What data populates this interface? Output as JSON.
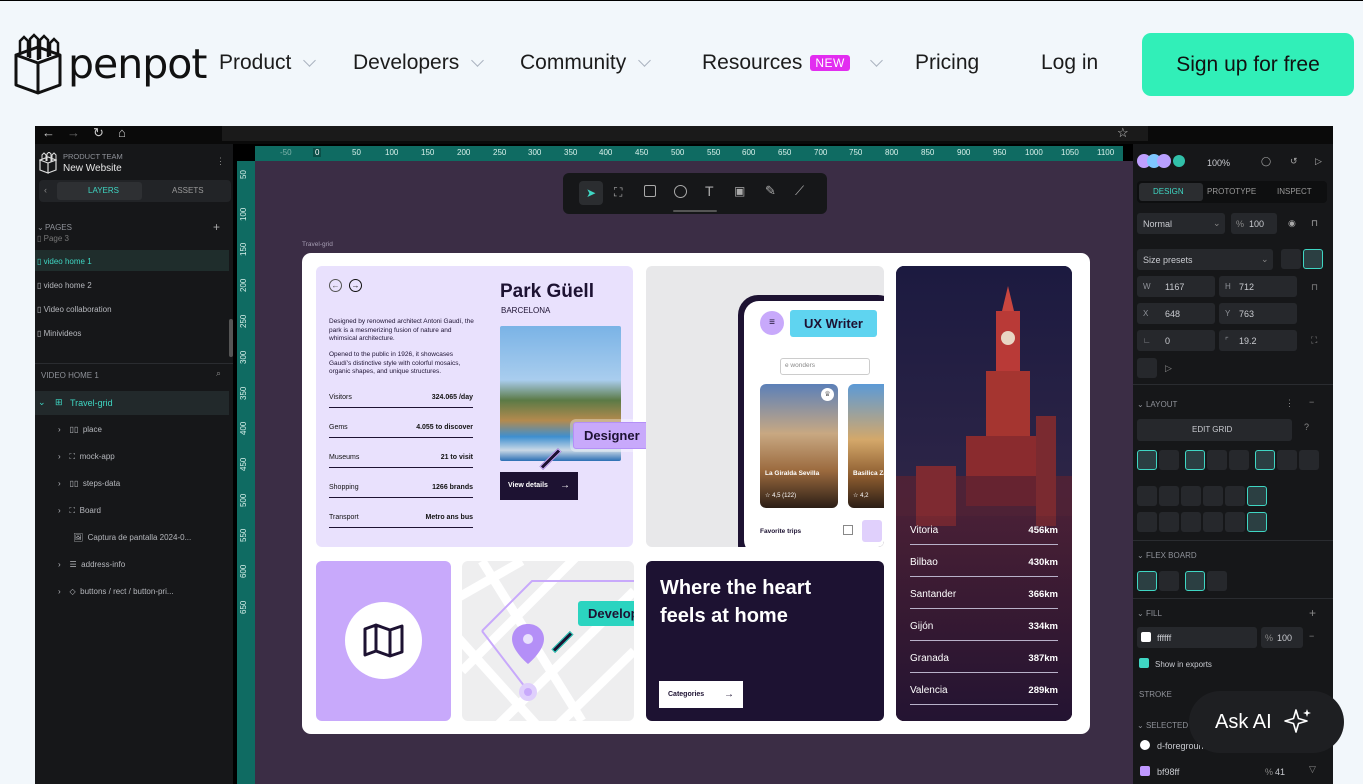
{
  "nav": {
    "logo_text": "penpot",
    "product": "Product",
    "developers": "Developers",
    "community": "Community",
    "resources": "Resources",
    "new_badge": "NEW",
    "pricing": "Pricing",
    "login": "Log in",
    "signup": "Sign up for free"
  },
  "left_panel": {
    "team": "PRODUCT TEAM",
    "project": "New Website",
    "tabs": [
      "LAYERS",
      "ASSETS"
    ],
    "pages_label": "PAGES",
    "pages": [
      "Page 3",
      "video home 1",
      "video home 2",
      "Video collaboration",
      "Minivideos"
    ],
    "section": "VIDEO HOME 1",
    "layers": [
      "Travel-grid",
      "place",
      "mock-app",
      "steps-data",
      "Board",
      "Captura de pantalla 2024-0...",
      "address-info",
      "buttons / rect / button-pri..."
    ]
  },
  "ruler": {
    "top": [
      "-50",
      "0",
      "50",
      "100",
      "150",
      "200",
      "250",
      "300",
      "350",
      "400",
      "450",
      "500",
      "550",
      "600",
      "650",
      "700",
      "750",
      "800",
      "850",
      "900",
      "950",
      "1000",
      "1050",
      "1100"
    ],
    "left": [
      "50",
      "100",
      "150",
      "200",
      "250",
      "300",
      "350",
      "400",
      "450",
      "500",
      "550",
      "600",
      "650"
    ]
  },
  "canvas": {
    "board_label": "Travel-grid",
    "card1": {
      "title": "Park Güell",
      "city": "BARCELONA",
      "desc1": "Designed by renowned architect Antoni Gaudí, the park is a mesmerizing fusion of nature and whimsical architecture.",
      "desc2": "Opened to the public in 1926, it showcases Gaudí's distinctive style with colorful mosaics, organic shapes, and unique structures.",
      "stats": [
        {
          "label": "Visitors",
          "value": "324.065 /day"
        },
        {
          "label": "Gems",
          "value": "4.055 to discover"
        },
        {
          "label": "Museums",
          "value": "21 to visit"
        },
        {
          "label": "Shopping",
          "value": "1266 brands"
        },
        {
          "label": "Transport",
          "value": "Metro ans bus"
        }
      ],
      "button": "View details",
      "cursor_tag": "Designer"
    },
    "card2": {
      "cursor_tag": "UX Writer",
      "search": "e wonders",
      "tile1_name": "La Giralda Sevilla",
      "tile1_rating": "4,5 (122)",
      "tile2_name": "Basilica Zaragoza",
      "tile2_rating": "4,2",
      "favorite": "Favorite trips"
    },
    "card3": {
      "cities": [
        {
          "name": "Vitoria",
          "dist": "456km"
        },
        {
          "name": "Bilbao",
          "dist": "430km"
        },
        {
          "name": "Santander",
          "dist": "366km"
        },
        {
          "name": "Gijón",
          "dist": "334km"
        },
        {
          "name": "Granada",
          "dist": "387km"
        },
        {
          "name": "Valencia",
          "dist": "289km"
        }
      ]
    },
    "card5": {
      "cursor_tag": "Developer"
    },
    "card6": {
      "line1": "Where the heart",
      "line2": "feels at home",
      "button": "Categories"
    }
  },
  "right_panel": {
    "zoom": "100%",
    "tabs": [
      "DESIGN",
      "PROTOTYPE",
      "INSPECT"
    ],
    "blend": "Normal",
    "opacity_pct": "%",
    "opacity": "100",
    "size_presets": "Size presets",
    "w_label": "W",
    "w": "1167",
    "h_label": "H",
    "h": "712",
    "x_label": "X",
    "x": "648",
    "y_label": "Y",
    "y": "763",
    "rotation": "0",
    "radius": "19.2",
    "layout": "LAYOUT",
    "edit_grid": "EDIT GRID",
    "flex_board": "FLEX BOARD",
    "fill": "FILL",
    "fill_value": "ffffff",
    "fill_opacity": "100",
    "show_exports": "Show in exports",
    "stroke": "STROKE",
    "selected": "SELECTED",
    "color1": "d-foreground-primary",
    "color2": "bf98ff",
    "color2_opacity": "41"
  },
  "askai": "Ask AI",
  "colors": {
    "brand": "#31efb8",
    "badge": "#e22df0",
    "canvas": "#3b2d45",
    "accent_teal": "#3fd6c3",
    "lilac": "#c8a9fb"
  }
}
